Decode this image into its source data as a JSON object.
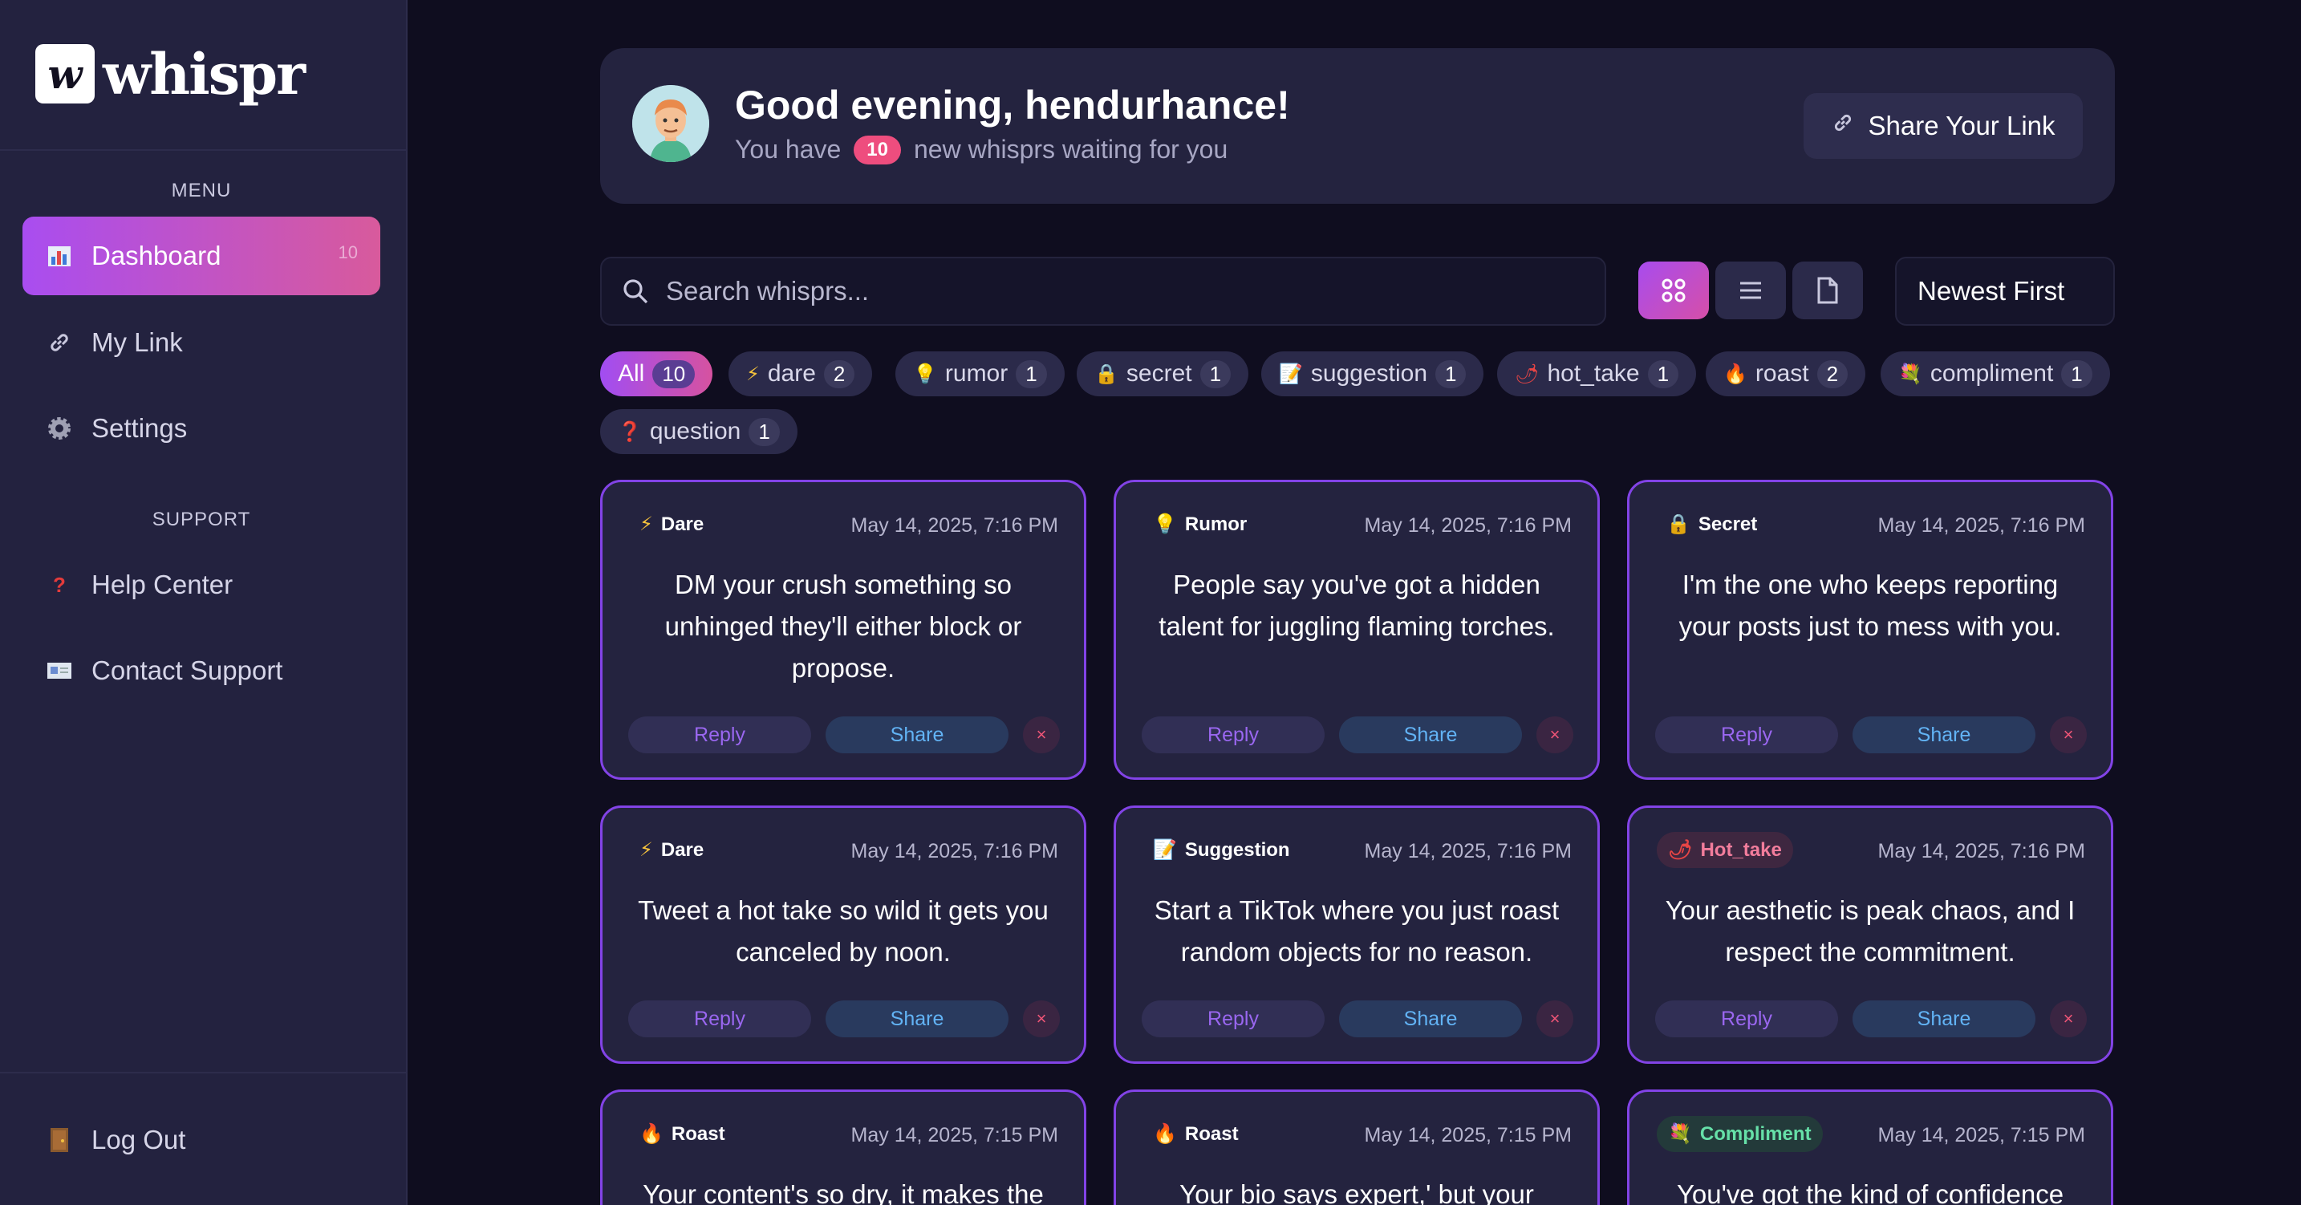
{
  "brand": {
    "logo_letter": "w",
    "name": "whispr"
  },
  "sidebar": {
    "menu_label": "MENU",
    "support_label": "SUPPORT",
    "items": [
      {
        "label": "Dashboard",
        "icon": "bar-chart-icon",
        "badge": "10"
      },
      {
        "label": "My Link",
        "icon": "link-icon"
      },
      {
        "label": "Settings",
        "icon": "gear-icon"
      }
    ],
    "support_items": [
      {
        "label": "Help Center",
        "icon": "question-icon"
      },
      {
        "label": "Contact Support",
        "icon": "envelope-icon"
      }
    ],
    "logout_label": "Log Out"
  },
  "header": {
    "greeting": "Good evening, hendurhance!",
    "sub_prefix": "You have",
    "new_count": "10",
    "sub_suffix": "new whisprs waiting for you",
    "share_link_label": "Share Your Link"
  },
  "toolbar": {
    "search_placeholder": "Search whisprs...",
    "sort_label": "Newest First"
  },
  "filters": [
    {
      "label": "All",
      "count": "10",
      "icon": ""
    },
    {
      "label": "dare",
      "count": "2",
      "icon": "⚡"
    },
    {
      "label": "rumor",
      "count": "1",
      "icon": "💡"
    },
    {
      "label": "secret",
      "count": "1",
      "icon": "🔒"
    },
    {
      "label": "suggestion",
      "count": "1",
      "icon": "📝"
    },
    {
      "label": "hot_take",
      "count": "1",
      "icon": "🌶"
    },
    {
      "label": "roast",
      "count": "2",
      "icon": "🔥"
    },
    {
      "label": "compliment",
      "count": "1",
      "icon": "💐"
    },
    {
      "label": "question",
      "count": "1",
      "icon": "❓"
    }
  ],
  "actions": {
    "reply": "Reply",
    "share": "Share",
    "delete": "×"
  },
  "cards": [
    {
      "type": "Dare",
      "icon": "⚡",
      "date": "May 14, 2025, 7:16 PM",
      "text": "DM your crush something so unhinged they'll either block or propose."
    },
    {
      "type": "Rumor",
      "icon": "💡",
      "date": "May 14, 2025, 7:16 PM",
      "text": "People say you've got a hidden talent for juggling flaming torches."
    },
    {
      "type": "Secret",
      "icon": "🔒",
      "date": "May 14, 2025, 7:16 PM",
      "text": "I'm the one who keeps reporting your posts just to mess with you."
    },
    {
      "type": "Dare",
      "icon": "⚡",
      "date": "May 14, 2025, 7:16 PM",
      "text": "Tweet a hot take so wild it gets you canceled by noon."
    },
    {
      "type": "Suggestion",
      "icon": "📝",
      "date": "May 14, 2025, 7:16 PM",
      "text": "Start a TikTok where you just roast random objects for no reason."
    },
    {
      "type": "Hot_take",
      "icon": "🌶",
      "date": "May 14, 2025, 7:16 PM",
      "text": "Your aesthetic is peak chaos, and I respect the commitment."
    },
    {
      "type": "Roast",
      "icon": "🔥",
      "date": "May 14, 2025, 7:15 PM",
      "text": "Your content's so dry, it makes the"
    },
    {
      "type": "Roast",
      "icon": "🔥",
      "date": "May 14, 2025, 7:15 PM",
      "text": "Your bio says expert,' but your"
    },
    {
      "type": "Compliment",
      "icon": "💐",
      "date": "May 14, 2025, 7:15 PM",
      "text": "You've got the kind of confidence"
    }
  ]
}
